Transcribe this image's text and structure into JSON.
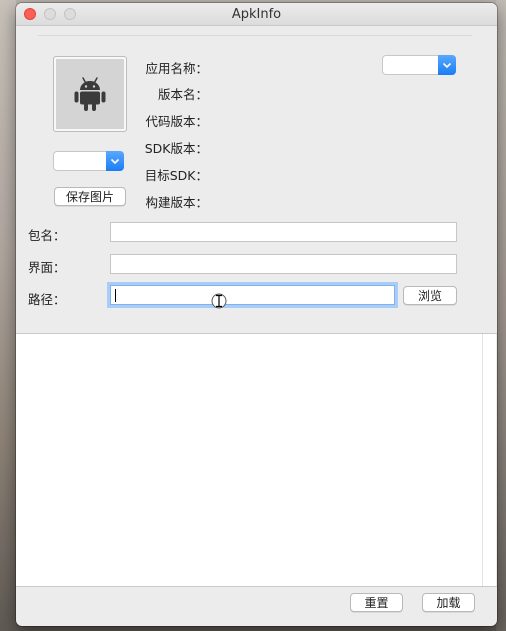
{
  "window": {
    "title": "ApkInfo"
  },
  "info_labels": {
    "app_name": "应用名称：",
    "version_name": "版本名：",
    "version_code": "代码版本：",
    "sdk_version": "SDK版本：",
    "target_sdk": "目标SDK：",
    "build_version": "构建版本："
  },
  "buttons": {
    "save_image": "保存图片",
    "browse": "浏览",
    "reset": "重置",
    "load": "加载"
  },
  "fields": {
    "package_label": "包名：",
    "package_value": "",
    "activity_label": "界面：",
    "activity_value": "",
    "path_label": "路径：",
    "path_value": ""
  },
  "selects": {
    "language_value": "",
    "icon_size_value": ""
  },
  "colors": {
    "close": "#fc5f57",
    "accent": "#1a7df5",
    "focus": "#a9cdf6"
  },
  "icons": {
    "app_icon": "android-icon"
  }
}
